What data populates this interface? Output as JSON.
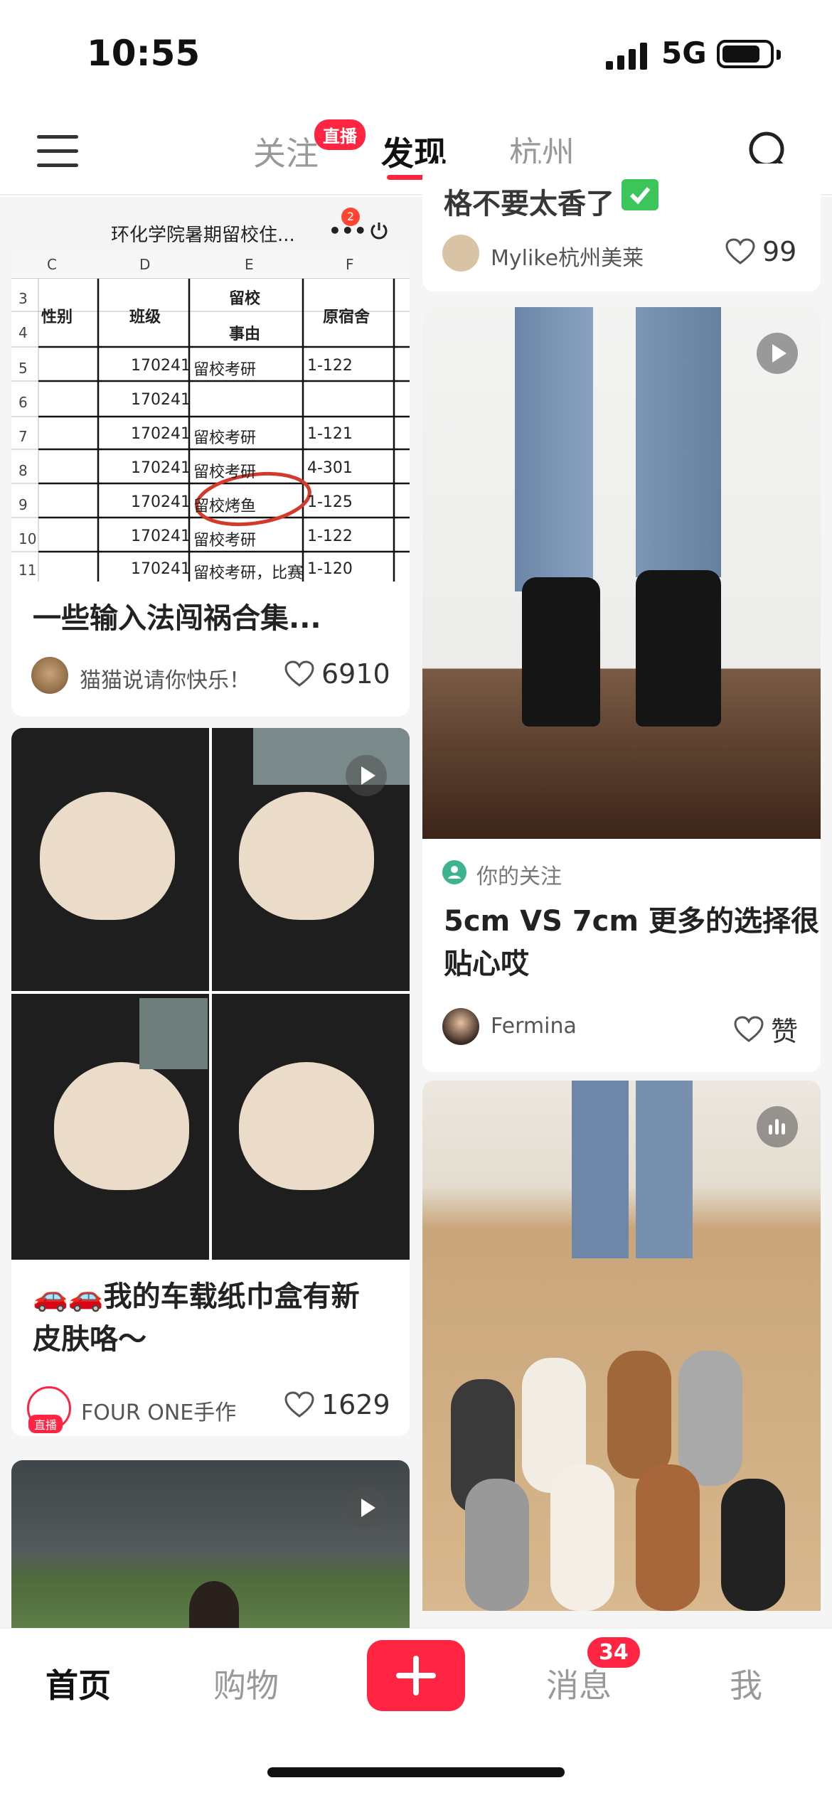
{
  "status_bar": {
    "time": "10:55",
    "network": "5G"
  },
  "top_nav": {
    "tabs": [
      {
        "label": "关注",
        "badge": "直播"
      },
      {
        "label": "发现"
      },
      {
        "label": "杭州"
      }
    ]
  },
  "feed": {
    "left": [
      {
        "image_text": {
          "sheet_title": "环化学院暑期留校住...",
          "col_headers": [
            "C",
            "D",
            "E",
            "F"
          ],
          "headers": [
            "性别",
            "班级",
            "留校",
            "事由",
            "原宿舍"
          ],
          "row_numbers": [
            "3",
            "4",
            "5",
            "6",
            "7",
            "8",
            "9",
            "10",
            "11"
          ],
          "rows": [
            {
              "cls": "170241",
              "reason": "留校考研",
              "room": "1-122"
            },
            {
              "cls": "170241",
              "reason": "",
              "room": ""
            },
            {
              "cls": "170241",
              "reason": "留校考研",
              "room": "1-121"
            },
            {
              "cls": "170241",
              "reason": "留校考研",
              "room": "4-301"
            },
            {
              "cls": "170241",
              "reason": "留校烤鱼",
              "room": "1-125"
            },
            {
              "cls": "170241",
              "reason": "留校考研",
              "room": "1-122"
            },
            {
              "cls": "170241",
              "reason": "留校考研，比赛",
              "room": "1-120"
            }
          ]
        },
        "title": "一些输入法闯祸合集...",
        "author": "猫猫说请你快乐！",
        "likes": "6910"
      },
      {
        "title_line1": "🚗🚗我的车载纸巾盒有新",
        "title_line2": "皮肤咯～",
        "author": "FOUR ONE手作",
        "avatar_badge": "直播",
        "likes": "1629"
      },
      {
        "has_video": true
      }
    ],
    "right": [
      {
        "title_partial": "格不要太香了",
        "author": "Mylike杭州美莱",
        "likes": "99"
      },
      {
        "follow_tag": "你的关注",
        "title_line1": "5cm VS 7cm 更多的选择很",
        "title_line2": "贴心哎",
        "author": "Fermina",
        "likes": "赞"
      },
      {
        "has_audio": true
      }
    ]
  },
  "bottom_nav": {
    "items": [
      {
        "label": "首页"
      },
      {
        "label": "购物"
      },
      {
        "label": "消息",
        "badge": "34"
      },
      {
        "label": "我"
      }
    ]
  },
  "colors": {
    "accent": "#ff2442"
  }
}
